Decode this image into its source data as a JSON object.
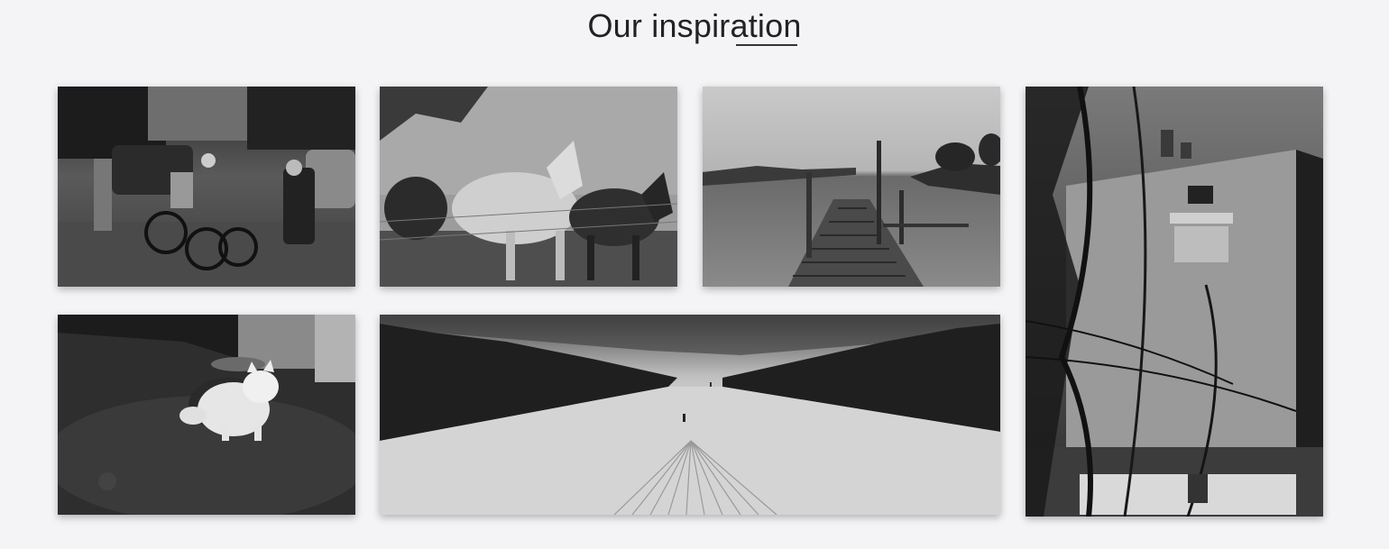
{
  "section": {
    "title": "Our inspiration"
  },
  "gallery": {
    "images": [
      {
        "id": "street-scene",
        "description": "street-scene-photo"
      },
      {
        "id": "horses",
        "description": "horses-photo"
      },
      {
        "id": "pier",
        "description": "lake-pier-photo"
      },
      {
        "id": "house",
        "description": "house-trees-photo"
      },
      {
        "id": "cat",
        "description": "white-cat-photo"
      },
      {
        "id": "ski-slope",
        "description": "ski-slope-photo"
      }
    ]
  }
}
